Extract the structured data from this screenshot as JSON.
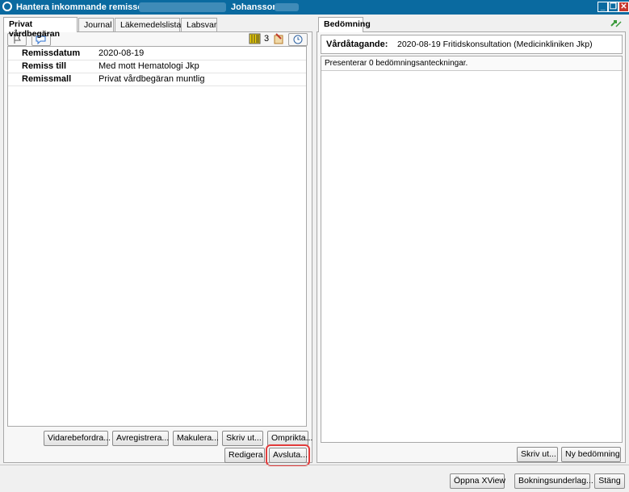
{
  "window": {
    "title": "Hantera inkommande remisser",
    "patient_surname": "Johansson",
    "minimize_glyph": "_",
    "restore_glyph": "❐",
    "close_glyph": "✕"
  },
  "left": {
    "tabs": [
      {
        "label": "Privat vårdbegäran"
      },
      {
        "label": "Journal"
      },
      {
        "label": "Läkemedelslista"
      },
      {
        "label": "Labsvar"
      }
    ],
    "toolbar": {
      "count": "3",
      "icons": [
        "flag-icon",
        "comment-icon",
        "barcode-icon",
        "attachment-icon",
        "clock-icon"
      ]
    },
    "fields": [
      {
        "label": "Remissdatum",
        "value": "2020-08-19"
      },
      {
        "label": "Remiss till",
        "value": "Med mott Hematologi Jkp"
      },
      {
        "label": "Remissmall",
        "value": "Privat vårdbegäran muntlig"
      }
    ],
    "buttons_row1": [
      "Vidarebefordra...",
      "Avregistrera...",
      "Makulera...",
      "Skriv ut...",
      "Omprikta..."
    ],
    "buttons_row2": [
      "Redigera",
      "Avsluta..."
    ]
  },
  "right": {
    "tab": "Bedömning",
    "vardatagande_label": "Vårdåtagande:",
    "vardatagande_value": "2020-08-19 Fritidskonsultation (Medicinkliniken Jkp)",
    "presenting": "Presenterar 0 bedömningsanteckningar.",
    "buttons": [
      "Skriv ut...",
      "Ny bedömning"
    ]
  },
  "footer": {
    "buttons": [
      "Öppna XView",
      "Bokningsunderlag...",
      "Stäng"
    ]
  },
  "colors": {
    "titlebar": "#0a6aa0",
    "highlight": "#e23b3b"
  }
}
